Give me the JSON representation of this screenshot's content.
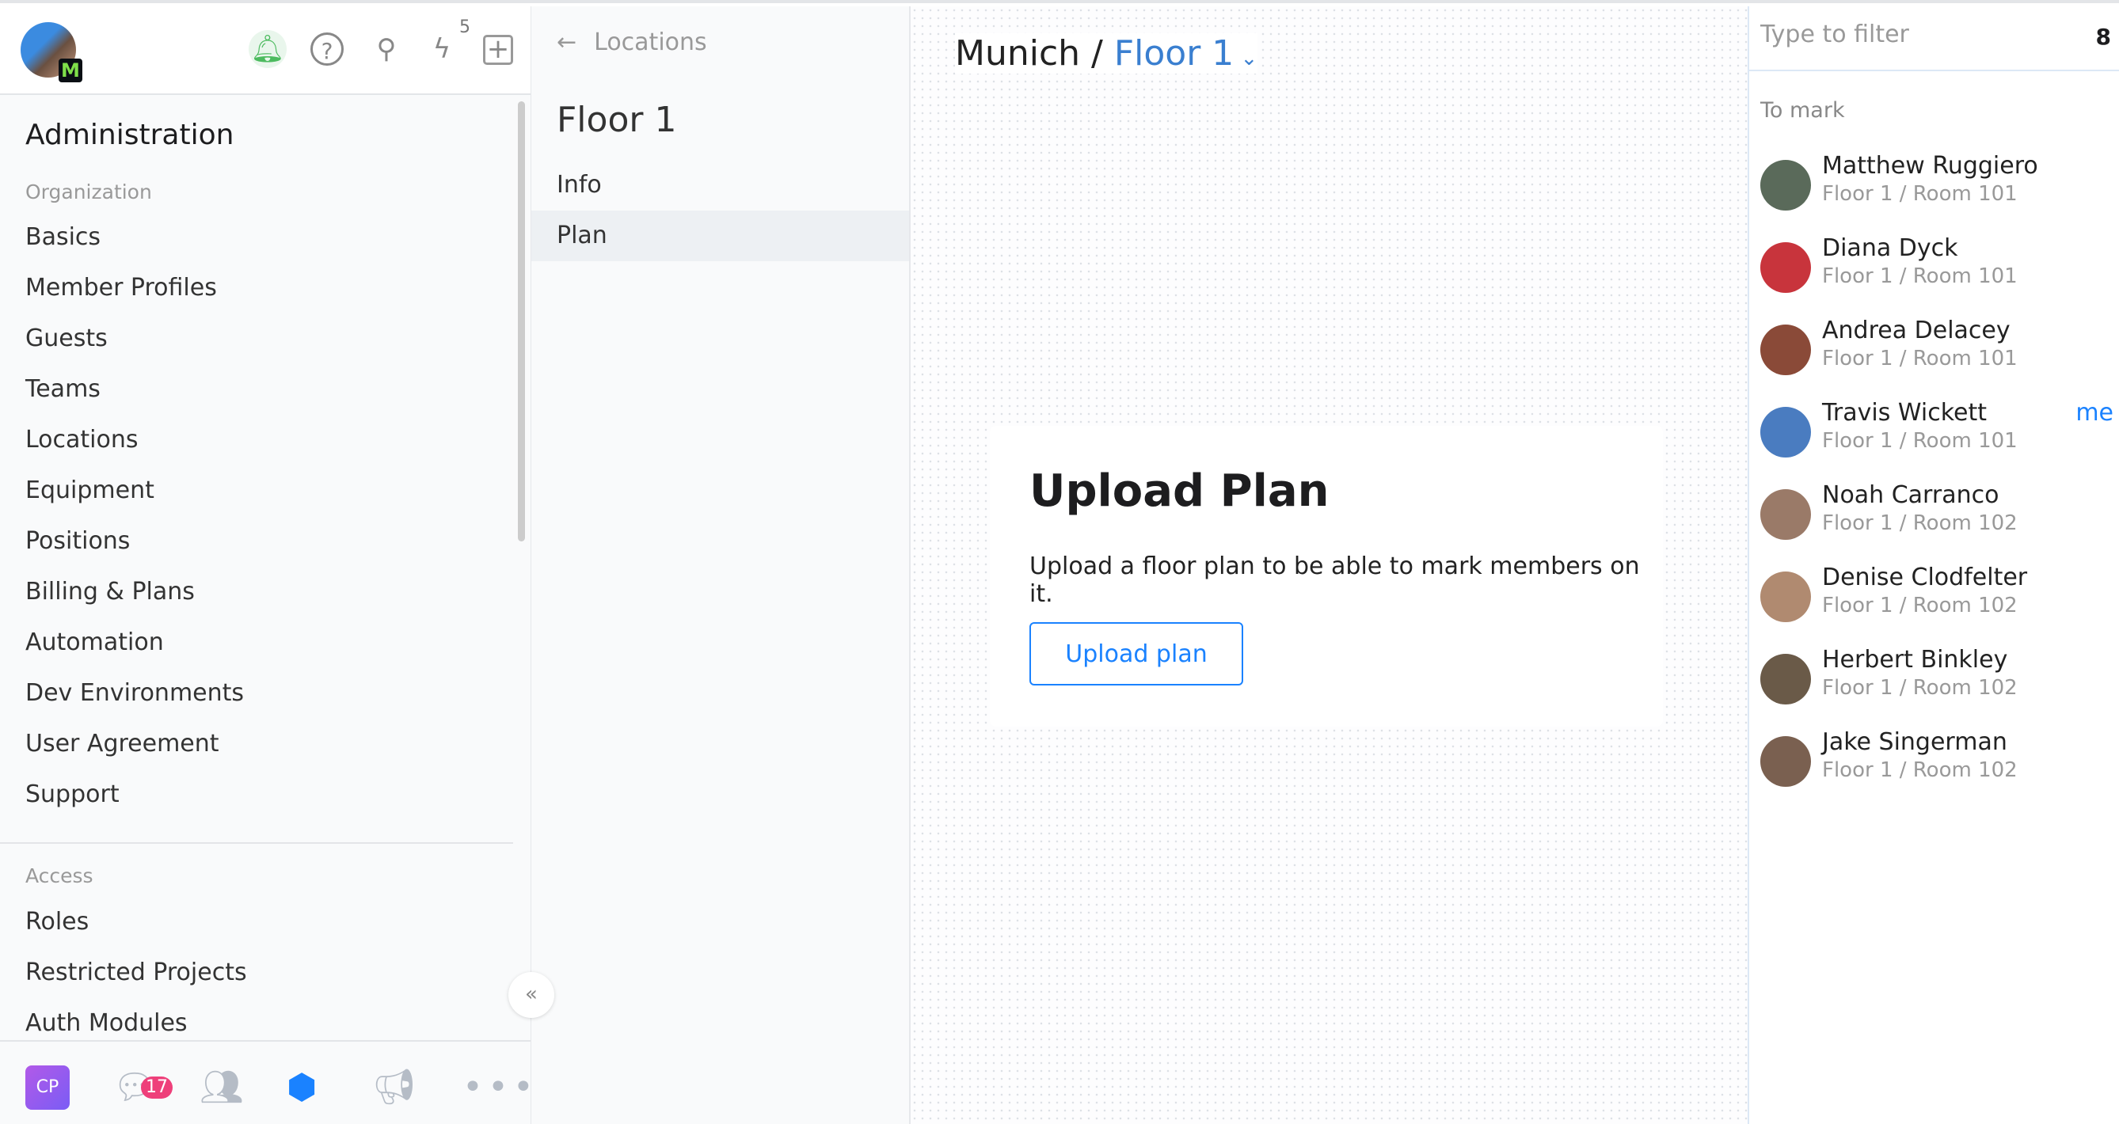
{
  "header": {
    "icons": [
      "bell-icon",
      "help-icon",
      "search-icon",
      "bolt-icon",
      "plus-icon"
    ],
    "bolt_count": "5",
    "badge_letter": "M"
  },
  "sidebar": {
    "title": "Administration",
    "org_label": "Organization",
    "org_items": [
      "Basics",
      "Member Profiles",
      "Guests",
      "Teams",
      "Locations",
      "Equipment",
      "Positions",
      "Billing & Plans",
      "Automation",
      "Dev Environments",
      "User Agreement",
      "Support"
    ],
    "access_label": "Access",
    "access_items": [
      "Roles",
      "Restricted Projects",
      "Auth Modules"
    ]
  },
  "footer": {
    "cp_label": "CP",
    "chat_badge": "17"
  },
  "middle": {
    "back_label": "Locations",
    "title": "Floor 1",
    "items": [
      {
        "label": "Info",
        "active": false
      },
      {
        "label": "Plan",
        "active": true
      }
    ]
  },
  "main": {
    "location": "Munich",
    "separator": " / ",
    "floor": "Floor 1",
    "card": {
      "title": "Upload Plan",
      "description": "Upload a floor plan to be able to mark members on it.",
      "button": "Upload plan"
    }
  },
  "right": {
    "filter_placeholder": "Type to filter",
    "count": "8",
    "section": "To mark",
    "me_label": "me",
    "people": [
      {
        "name": "Matthew Ruggiero",
        "room": "Floor 1 / Room 101",
        "color": "#5a6a5a"
      },
      {
        "name": "Diana Dyck",
        "room": "Floor 1 / Room 101",
        "color": "#c8343c"
      },
      {
        "name": "Andrea Delacey",
        "room": "Floor 1 / Room 101",
        "color": "#8a4a38"
      },
      {
        "name": "Travis Wickett",
        "room": "Floor 1 / Room 101",
        "color": "#4a7cc0",
        "me": true
      },
      {
        "name": "Noah Carranco",
        "room": "Floor 1 / Room 102",
        "color": "#9a7a68"
      },
      {
        "name": "Denise Clodfelter",
        "room": "Floor 1 / Room 102",
        "color": "#b08a70"
      },
      {
        "name": "Herbert Binkley",
        "room": "Floor 1 / Room 102",
        "color": "#6a5a48"
      },
      {
        "name": "Jake Singerman",
        "room": "Floor 1 / Room 102",
        "color": "#7a6050"
      }
    ]
  },
  "colors": {
    "accent": "#1a82ff",
    "badge": "#ee3f7a",
    "bell": "#4cbb5f"
  }
}
